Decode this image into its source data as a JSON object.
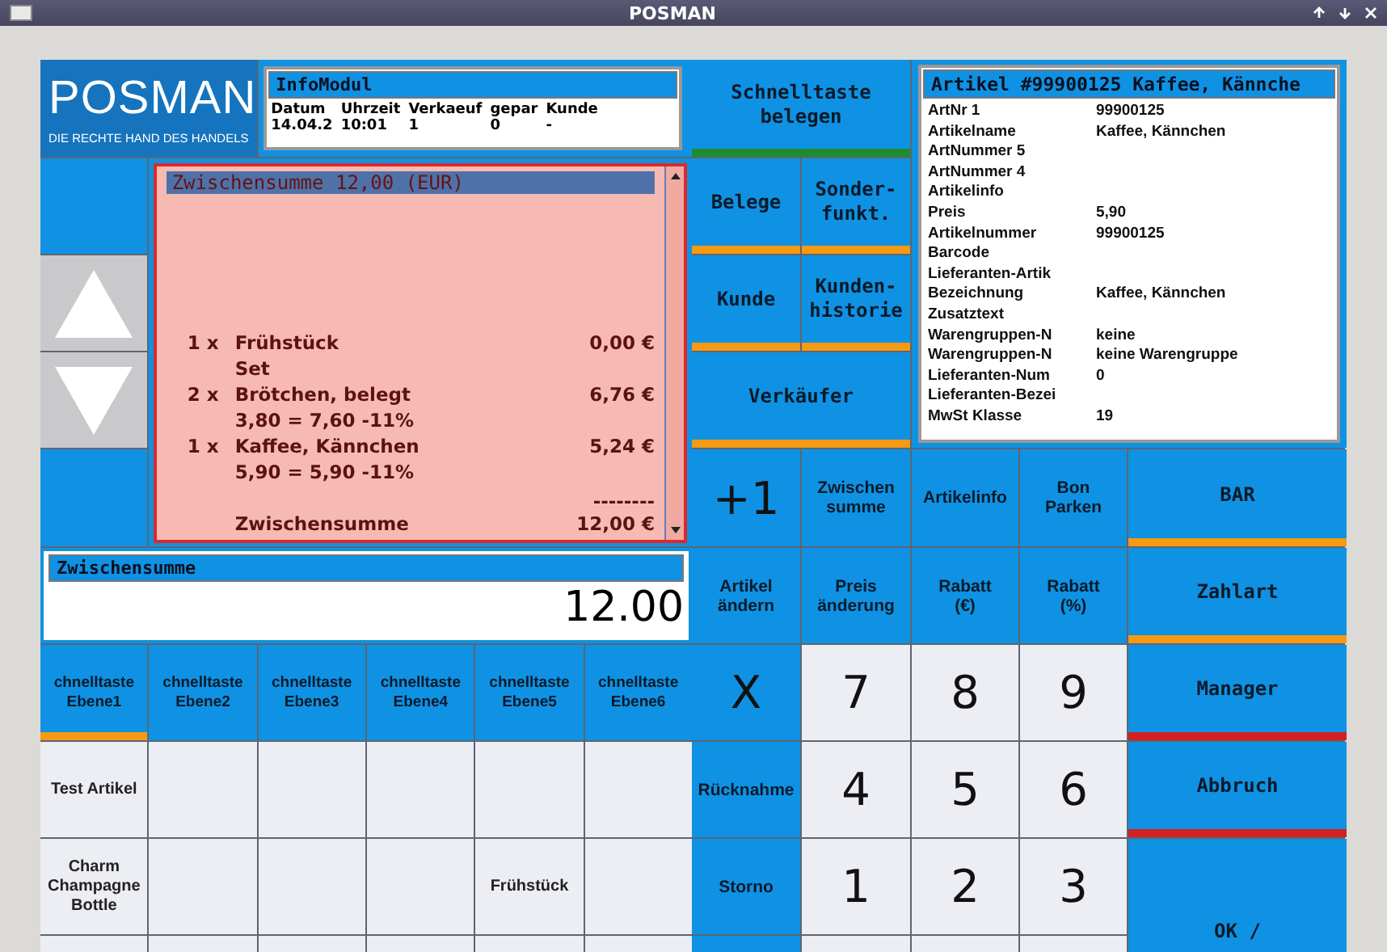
{
  "title_bar": {
    "title": "POSMAN"
  },
  "logo": {
    "name": "POSMAN",
    "tagline": "DIE RECHTE HAND DES HANDELS"
  },
  "info_modul": {
    "title": "InfoModul",
    "columns": [
      "Datum",
      "Uhrzeit",
      "Verkaeuf",
      "gepar",
      "Kunde"
    ],
    "values": [
      "14.04.2",
      "10:01",
      "1",
      "0",
      "-"
    ]
  },
  "receipt": {
    "title": "Zwischensumme 12,00 (EUR)",
    "lines": [
      {
        "qty": "1 x",
        "name": "Frühstück",
        "price": "0,00 €"
      },
      {
        "name": "Set"
      },
      {
        "qty": "2 x",
        "name": "Brötchen, belegt",
        "price": "6,76 €"
      },
      {
        "name": "3,80 = 7,60 -11%"
      },
      {
        "qty": "1 x",
        "name": "Kaffee, Kännchen",
        "price": "5,24 €"
      },
      {
        "name": "5,90 = 5,90 -11%"
      }
    ],
    "separator": "--------",
    "total": {
      "label": "Zwischensumme",
      "value": "12,00 €"
    }
  },
  "subtotal_display": {
    "label": "Zwischensumme",
    "value": "12.00"
  },
  "quick_tabs": [
    {
      "label": "chnelltaste Ebene1",
      "selected": true
    },
    {
      "label": "chnelltaste Ebene2",
      "selected": false
    },
    {
      "label": "chnelltaste Ebene3",
      "selected": false
    },
    {
      "label": "chnelltaste Ebene4",
      "selected": false
    },
    {
      "label": "chnelltaste Ebene5",
      "selected": false
    },
    {
      "label": "chnelltaste Ebene6",
      "selected": false
    }
  ],
  "quick_rows": [
    [
      "Test Artikel",
      null,
      null,
      null,
      null,
      null
    ],
    [
      "Charm Champagne Bottle",
      null,
      null,
      null,
      "Frühstück",
      null
    ],
    [
      null,
      null,
      null,
      null,
      null,
      null
    ]
  ],
  "top_buttons": [
    {
      "label": "Schnelltaste\nbelegen",
      "color": "#1e8c2e"
    },
    {
      "label": "Belege",
      "color": "#f59a12"
    },
    {
      "label": "Sonder-\nfunkt.",
      "color": "#f59a12"
    },
    {
      "label": "Kunde",
      "color": "#f59a12"
    },
    {
      "label": "Kunden-\nhistorie",
      "color": "#f59a12"
    },
    {
      "label": "Verkäufer",
      "color": "#f59a12"
    }
  ],
  "article_info": {
    "title": "Artikel #99900125 Kaffee, Kännche",
    "fields": [
      {
        "label": "ArtNr 1",
        "value": "99900125"
      },
      {
        "label": "Artikelname",
        "value": "Kaffee, Kännchen"
      },
      {
        "label": "ArtNummer 5"
      },
      {
        "label": "ArtNummer 4"
      },
      {
        "label": "Artikelinfo"
      },
      {
        "label": "Preis",
        "value": "5,90"
      },
      {
        "label": "Artikelnummer",
        "value": "99900125"
      },
      {
        "label": "Barcode"
      },
      {
        "label": "Lieferanten-Artik"
      },
      {
        "label": "Bezeichnung",
        "value": "Kaffee, Kännchen"
      },
      {
        "label": "Zusatztext"
      },
      {
        "label": "Warengruppen-N",
        "value": "keine"
      },
      {
        "label": "Warengruppen-N",
        "value": "keine Warengruppe"
      },
      {
        "label": "Lieferanten-Num",
        "value": "0"
      },
      {
        "label": "Lieferanten-Bezei"
      },
      {
        "label": "MwSt Klasse",
        "value": "19"
      }
    ]
  },
  "keypad": [
    [
      {
        "label": "+1",
        "kind": "symbol"
      },
      {
        "label": "Zwischen\nsumme",
        "kind": "function"
      },
      {
        "label": "Artikelinfo",
        "kind": "function"
      },
      {
        "label": "Bon\nParken",
        "kind": "function"
      }
    ],
    [
      {
        "label": "Artikel\nändern",
        "kind": "function"
      },
      {
        "label": "Preis\nänderung",
        "kind": "function"
      },
      {
        "label": "Rabatt\n(€)",
        "kind": "function"
      },
      {
        "label": "Rabatt\n(%)",
        "kind": "function"
      }
    ],
    [
      {
        "label": "X",
        "kind": "symbol"
      },
      {
        "label": "7",
        "kind": "digit"
      },
      {
        "label": "8",
        "kind": "digit"
      },
      {
        "label": "9",
        "kind": "digit"
      }
    ],
    [
      {
        "label": "Rücknahme",
        "kind": "function"
      },
      {
        "label": "4",
        "kind": "digit"
      },
      {
        "label": "5",
        "kind": "digit"
      },
      {
        "label": "6",
        "kind": "digit"
      }
    ],
    [
      {
        "label": "Storno",
        "kind": "function"
      },
      {
        "label": "1",
        "kind": "digit"
      },
      {
        "label": "2",
        "kind": "digit"
      },
      {
        "label": "3",
        "kind": "digit"
      }
    ],
    [
      {
        "kind": "function"
      },
      {
        "kind": "digit"
      },
      {
        "kind": "digit"
      },
      {
        "kind": "digit"
      }
    ]
  ],
  "side_buttons": [
    {
      "label": "BAR",
      "color": "#f59a12"
    },
    {
      "label": "Zahlart",
      "color": "#f59a12"
    },
    {
      "label": "Manager",
      "color": "#d42020"
    },
    {
      "label": "Abbruch",
      "color": "#d42020"
    },
    {
      "label": "OK /"
    }
  ]
}
